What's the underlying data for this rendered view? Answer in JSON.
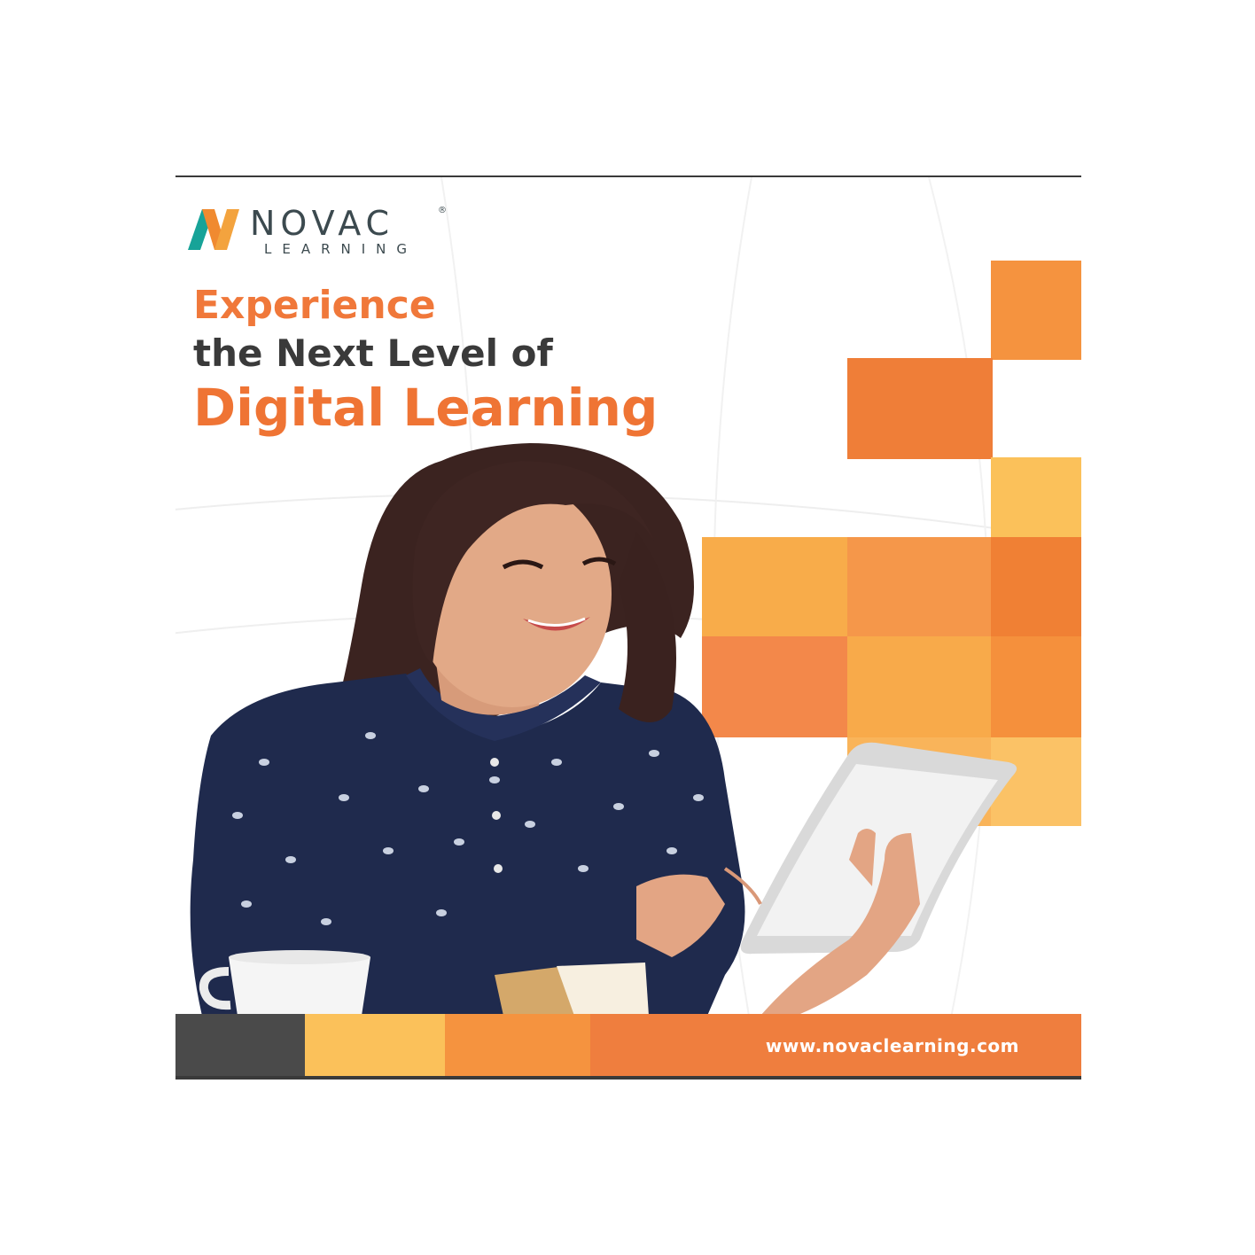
{
  "brand": {
    "name": "NOVAC",
    "registered": "®",
    "subtitle": "LEARNING"
  },
  "headline": {
    "line1": "Experience",
    "line2": "the Next Level of",
    "line3": "Digital Learning"
  },
  "footer": {
    "url": "www.novaclearning.com"
  },
  "colors": {
    "orange_primary": "#ef7434",
    "orange_mid": "#f5933f",
    "orange_light": "#f8b04c",
    "yellow_light": "#fbc15a",
    "dark_gray": "#4a4a4a",
    "text_dark": "#3a3a3a",
    "logo_teal": "#17a398",
    "logo_orange": "#f08a30",
    "shirt_navy": "#1f2a4d"
  },
  "icons": {
    "logo_mark": "triangular-n-logo-icon"
  }
}
